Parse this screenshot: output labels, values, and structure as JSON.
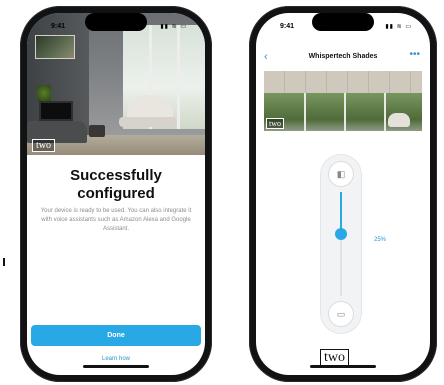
{
  "left_phone": {
    "status": {
      "time": "9:41",
      "icons": "▮▮ ≋ ▭"
    },
    "hero_logo": "two",
    "title": "Successfully configured",
    "description": "Your device is ready to be used. You can also integrate it with voice assistants such as Amazon Alexa and Google Assistant.",
    "done_label": "Done",
    "learn_label": "Learn how"
  },
  "right_phone": {
    "status": {
      "time": "9:41",
      "icons": "▮▮ ≋ ▭"
    },
    "nav": {
      "back_icon": "‹",
      "title": "Whispertech Shades",
      "more_icon": "•••"
    },
    "photo_logo": "two",
    "slider": {
      "value_percent": 25,
      "label": "25%",
      "top_icon": "◧",
      "bottom_icon": "▭"
    },
    "bottom_logo": "two"
  },
  "colors": {
    "accent": "#29a8e6",
    "link": "#2d93d8",
    "frame": "#111214"
  }
}
